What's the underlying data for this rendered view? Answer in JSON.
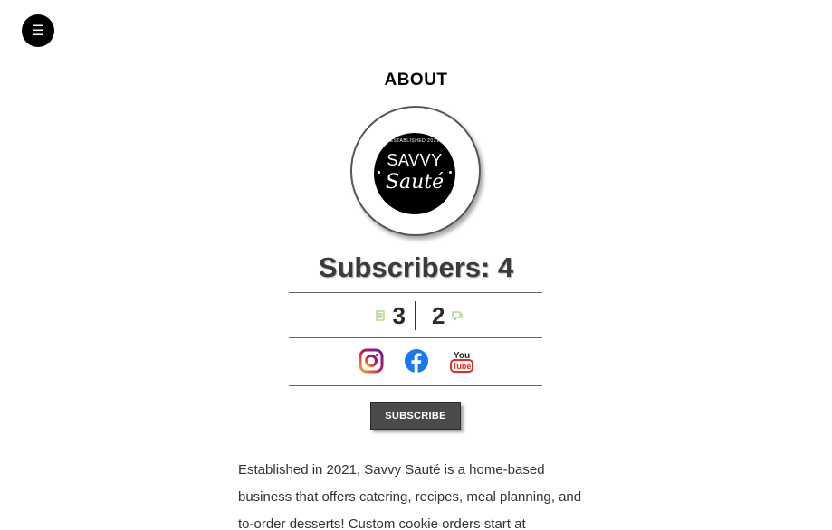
{
  "menu": {
    "icon": "menu-icon",
    "glyph": "☰"
  },
  "page_title": "ABOUT",
  "logo": {
    "top_text": "ESTABLISHED 2021",
    "name_line1": "SAVVY",
    "name_line2": "Sauté"
  },
  "subscribers": {
    "text": "Subscribers: 4"
  },
  "stats": {
    "posts_count": "3",
    "posts_icon": "document-icon",
    "comments_count": "2",
    "comments_icon": "comments-icon"
  },
  "social": [
    {
      "name": "instagram-icon",
      "color": "#6a1b9a"
    },
    {
      "name": "facebook-icon",
      "color": "#1877f2"
    },
    {
      "name": "youtube-icon",
      "color": "#e52d27"
    }
  ],
  "subscribe_button": "SUBSCRIBE",
  "body": {
    "line1": "Established in 2021, Savvy Sauté is a home-based",
    "line2": "business that offers catering, recipes, meal planning, and",
    "line3": "to-order desserts! Custom cookie orders start at"
  },
  "colors": {
    "accent_dark": "#4a4a4a",
    "icon_green": "#8bc34a"
  }
}
